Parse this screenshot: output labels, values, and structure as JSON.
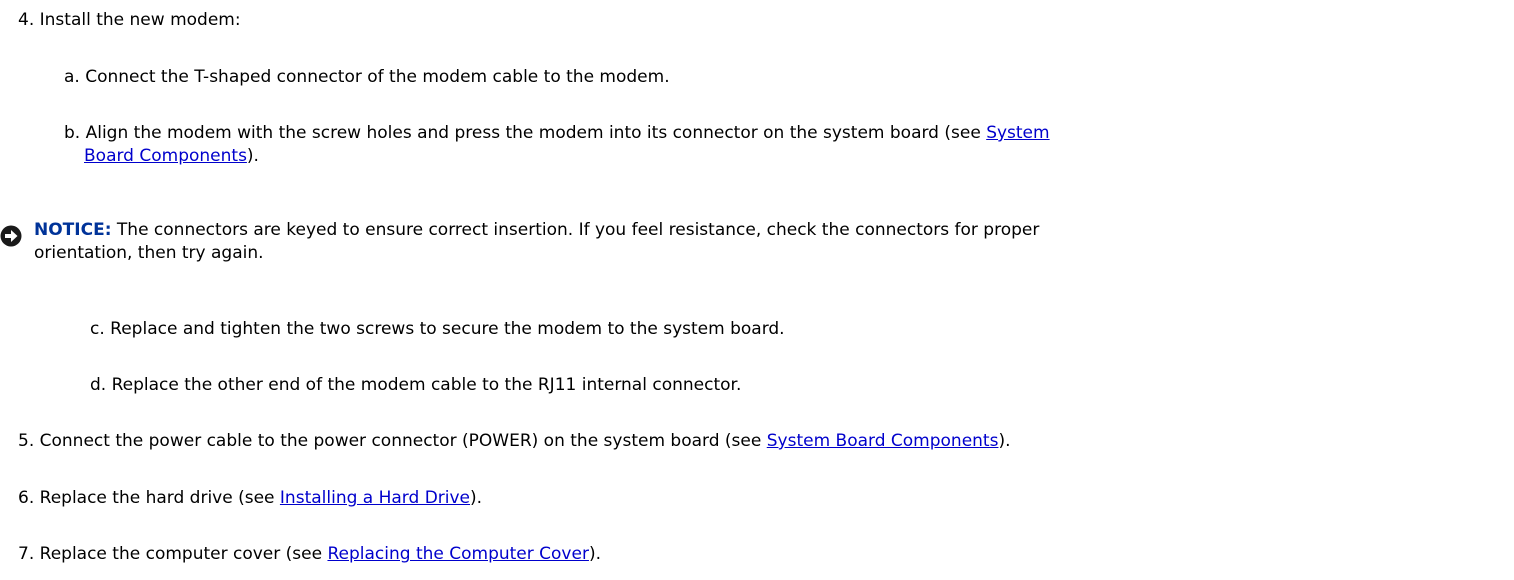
{
  "step4": {
    "num": "4.",
    "text": "Install the new modem:"
  },
  "step4a": {
    "num": "a.",
    "text": "Connect the T-shaped connector of the modem cable to the modem."
  },
  "step4b": {
    "num": "b.",
    "text_before": "Align the modem with the screw holes and press the modem into its connector on the system board (see ",
    "link_part1": "System",
    "link_part2": "Board Components",
    "text_after": ")."
  },
  "notice": {
    "label": "NOTICE:",
    "text_line1": " The connectors are keyed to ensure correct insertion. If you feel resistance, check the connectors for proper",
    "text_line2": "orientation, then try again."
  },
  "step4c": {
    "num": "c.",
    "text": "Replace and tighten the two screws to secure the modem to the system board."
  },
  "step4d": {
    "num": "d.",
    "text": "Replace the other end of the modem cable to the RJ11 internal connector."
  },
  "step5": {
    "num": "5.",
    "text_before": "Connect the power cable to the power connector (POWER) on the system board (see ",
    "link": "System Board Components",
    "text_after": ")."
  },
  "step6": {
    "num": "6.",
    "text_before": "Replace the hard drive (see ",
    "link": "Installing a Hard Drive",
    "text_after": ")."
  },
  "step7": {
    "num": "7.",
    "text_before": "Replace the computer cover (see ",
    "link": "Replacing the Computer Cover",
    "text_after": ")."
  },
  "colors": {
    "link": "#0000cc",
    "notice_label": "#003399",
    "notice_icon": "#1a1a1a"
  },
  "icons": {
    "notice": "notice-arrow-icon"
  }
}
